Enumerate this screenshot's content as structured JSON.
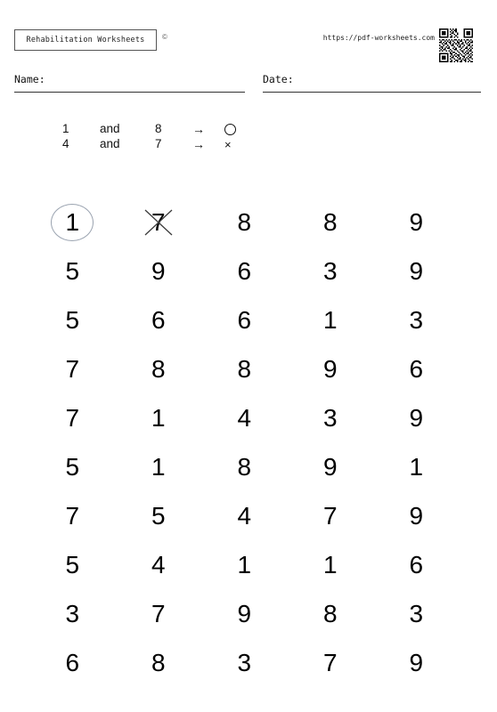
{
  "header": {
    "brand_label": "Rehabilitation Worksheets",
    "copyright_symbol": "©",
    "url": "https://pdf-worksheets.com",
    "qr_code_alt": "qr-code"
  },
  "fields": {
    "name_label": "Name:",
    "name_value": "",
    "date_label": "Date:",
    "date_value": ""
  },
  "legend": {
    "rows": [
      {
        "digit": "1",
        "conjunction": "and",
        "digit2": "8",
        "arrow": "→",
        "symbol": "circle"
      },
      {
        "digit": "4",
        "conjunction": "and",
        "digit2": "7",
        "arrow": "→",
        "symbol": "cross"
      }
    ],
    "cross_glyph": "×"
  },
  "grid": {
    "columns": 5,
    "rows": [
      [
        "1",
        "7",
        "8",
        "8",
        "9"
      ],
      [
        "5",
        "9",
        "6",
        "3",
        "9"
      ],
      [
        "5",
        "6",
        "6",
        "1",
        "3"
      ],
      [
        "7",
        "8",
        "8",
        "9",
        "6"
      ],
      [
        "7",
        "1",
        "4",
        "3",
        "9"
      ],
      [
        "5",
        "1",
        "8",
        "9",
        "1"
      ],
      [
        "7",
        "5",
        "4",
        "7",
        "9"
      ],
      [
        "5",
        "4",
        "1",
        "1",
        "6"
      ],
      [
        "3",
        "7",
        "9",
        "8",
        "3"
      ],
      [
        "6",
        "8",
        "3",
        "7",
        "9"
      ]
    ],
    "marks": [
      {
        "row": 0,
        "col": 0,
        "type": "circle"
      },
      {
        "row": 0,
        "col": 1,
        "type": "cross"
      }
    ]
  },
  "colors": {
    "text": "#000000",
    "circle_mark": "#9aa3b0",
    "cross_mark": "#3a3a3a",
    "rule": "#333333"
  }
}
